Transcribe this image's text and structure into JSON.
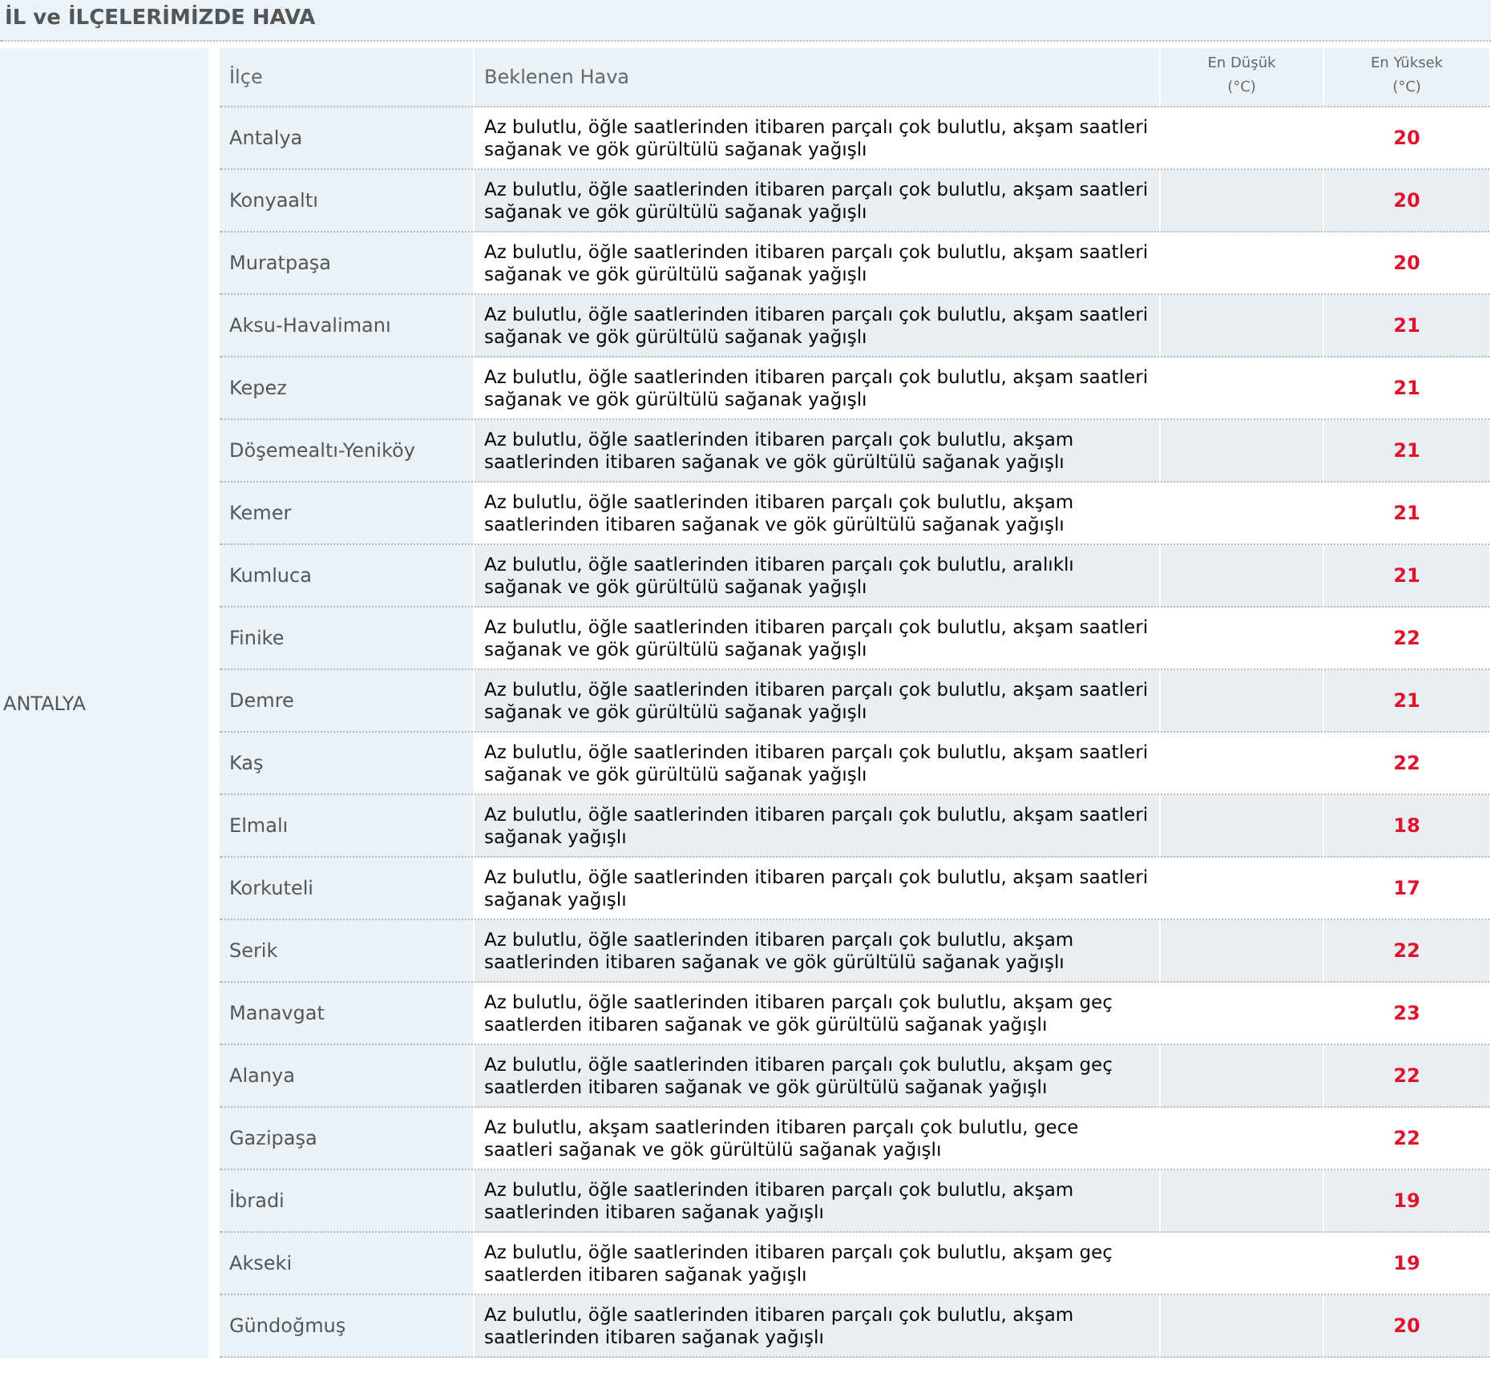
{
  "title": "İL ve İLÇELERİMİZDE HAVA",
  "province": "ANTALYA",
  "columns": [
    {
      "label": "İlçe"
    },
    {
      "label": "Beklenen Hava"
    },
    {
      "label": "En Düşük",
      "unit": "(°C)"
    },
    {
      "label": "En Yüksek",
      "unit": "(°C)"
    }
  ],
  "rows": [
    {
      "district": "Antalya",
      "forecast": "Az bulutlu, öğle saatlerinden itibaren parçalı çok bulutlu, akşam saatleri sağanak ve gök gürültülü sağanak yağışlı",
      "max": "20"
    },
    {
      "district": "Konyaaltı",
      "forecast": "Az bulutlu, öğle saatlerinden itibaren parçalı çok bulutlu, akşam saatleri sağanak ve gök gürültülü sağanak yağışlı",
      "max": "20"
    },
    {
      "district": "Muratpaşa",
      "forecast": "Az bulutlu, öğle saatlerinden itibaren parçalı çok bulutlu, akşam saatleri sağanak ve gök gürültülü sağanak yağışlı",
      "max": "20"
    },
    {
      "district": "Aksu-Havalimanı",
      "forecast": "Az bulutlu, öğle saatlerinden itibaren parçalı çok bulutlu, akşam saatleri sağanak ve gök gürültülü sağanak yağışlı",
      "max": "21"
    },
    {
      "district": "Kepez",
      "forecast": "Az bulutlu, öğle saatlerinden itibaren parçalı çok bulutlu, akşam saatleri sağanak ve gök gürültülü sağanak yağışlı",
      "max": "21"
    },
    {
      "district": "Döşemealtı-Yeniköy",
      "forecast": "Az bulutlu, öğle saatlerinden itibaren parçalı çok bulutlu, akşam saatlerinden itibaren sağanak ve gök gürültülü sağanak yağışlı",
      "max": "21"
    },
    {
      "district": "Kemer",
      "forecast": "Az bulutlu, öğle saatlerinden itibaren parçalı çok bulutlu, akşam saatlerinden itibaren sağanak ve gök gürültülü sağanak yağışlı",
      "max": "21"
    },
    {
      "district": "Kumluca",
      "forecast": "Az bulutlu, öğle saatlerinden itibaren parçalı çok bulutlu, aralıklı sağanak ve gök gürültülü sağanak yağışlı",
      "max": "21"
    },
    {
      "district": "Finike",
      "forecast": "Az bulutlu, öğle saatlerinden itibaren parçalı çok bulutlu, akşam saatleri sağanak ve gök gürültülü sağanak yağışlı",
      "max": "22"
    },
    {
      "district": "Demre",
      "forecast": "Az bulutlu, öğle saatlerinden itibaren parçalı çok bulutlu, akşam saatleri sağanak ve gök gürültülü sağanak yağışlı",
      "max": "21"
    },
    {
      "district": "Kaş",
      "forecast": "Az bulutlu, öğle saatlerinden itibaren parçalı çok bulutlu, akşam saatleri sağanak ve gök gürültülü sağanak yağışlı",
      "max": "22"
    },
    {
      "district": "Elmalı",
      "forecast": "Az bulutlu, öğle saatlerinden itibaren parçalı çok bulutlu, akşam saatleri sağanak yağışlı",
      "max": "18"
    },
    {
      "district": "Korkuteli",
      "forecast": "Az bulutlu, öğle saatlerinden itibaren parçalı çok bulutlu, akşam saatleri sağanak yağışlı",
      "max": "17"
    },
    {
      "district": "Serik",
      "forecast": "Az bulutlu, öğle saatlerinden itibaren parçalı çok bulutlu, akşam saatlerinden itibaren sağanak ve gök gürültülü sağanak yağışlı",
      "max": "22"
    },
    {
      "district": "Manavgat",
      "forecast": "Az bulutlu, öğle saatlerinden itibaren parçalı çok bulutlu, akşam geç saatlerden itibaren sağanak ve gök gürültülü sağanak yağışlı",
      "max": "23"
    },
    {
      "district": "Alanya",
      "forecast": "Az bulutlu, öğle saatlerinden itibaren parçalı çok bulutlu, akşam geç saatlerden itibaren sağanak ve gök gürültülü sağanak yağışlı",
      "max": "22"
    },
    {
      "district": "Gazipaşa",
      "forecast": "Az bulutlu, akşam saatlerinden itibaren parçalı çok bulutlu, gece saatleri sağanak ve gök gürültülü sağanak yağışlı",
      "max": "22"
    },
    {
      "district": "İbradi",
      "forecast": "Az bulutlu, öğle saatlerinden itibaren parçalı çok bulutlu, akşam saatlerinden itibaren sağanak yağışlı",
      "max": "19"
    },
    {
      "district": "Akseki",
      "forecast": "Az bulutlu, öğle saatlerinden itibaren parçalı çok bulutlu, akşam geç saatlerden itibaren sağanak yağışlı",
      "max": "19"
    },
    {
      "district": "Gündoğmuş",
      "forecast": "Az bulutlu, öğle saatlerinden itibaren parçalı çok bulutlu, akşam saatlerinden itibaren sağanak yağışlı",
      "max": "20"
    }
  ]
}
